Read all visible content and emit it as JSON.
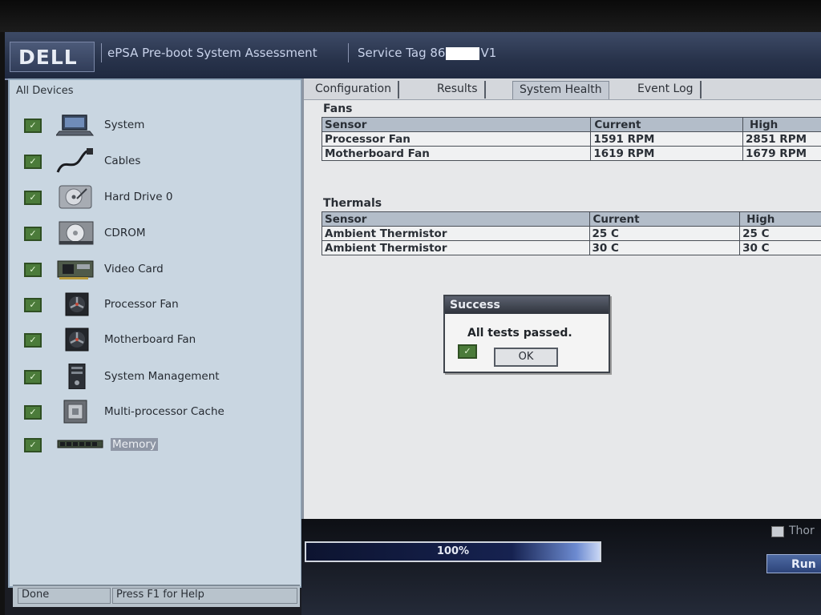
{
  "header": {
    "logo": "DELL",
    "title": "ePSA Pre-boot System Assessment",
    "service_tag_prefix": "Service Tag 86",
    "service_tag_suffix": "V1"
  },
  "left_panel": {
    "title": "All Devices",
    "devices": [
      {
        "label": "System",
        "icon": "laptop-icon",
        "checked": true
      },
      {
        "label": "Cables",
        "icon": "cable-icon",
        "checked": true
      },
      {
        "label": "Hard Drive 0",
        "icon": "hard-drive-icon",
        "checked": true
      },
      {
        "label": "CDROM",
        "icon": "cdrom-icon",
        "checked": true
      },
      {
        "label": "Video Card",
        "icon": "video-card-icon",
        "checked": true
      },
      {
        "label": "Processor Fan",
        "icon": "fan-icon",
        "checked": true
      },
      {
        "label": "Motherboard Fan",
        "icon": "fan-icon",
        "checked": true
      },
      {
        "label": "System Management",
        "icon": "system-management-icon",
        "checked": true
      },
      {
        "label": "Multi-processor Cache",
        "icon": "cpu-chip-icon",
        "checked": true
      },
      {
        "label": "Memory",
        "icon": "memory-module-icon",
        "checked": true,
        "selected": true
      }
    ],
    "status_done": "Done",
    "status_help": "Press F1 for Help"
  },
  "tabs": [
    {
      "label": "Configuration"
    },
    {
      "label": "Results"
    },
    {
      "label": "System Health",
      "active": true
    },
    {
      "label": "Event Log"
    }
  ],
  "fans": {
    "title": "Fans",
    "headers": [
      "Sensor",
      "Current",
      "High"
    ],
    "rows": [
      [
        "Processor Fan",
        "1591 RPM",
        "2851 RPM"
      ],
      [
        "Motherboard Fan",
        "1619 RPM",
        "1679 RPM"
      ]
    ]
  },
  "thermals": {
    "title": "Thermals",
    "headers": [
      "Sensor",
      "Current",
      "High"
    ],
    "rows": [
      [
        "Ambient Thermistor",
        "25 C",
        "25 C"
      ],
      [
        "Ambient Thermistor",
        "30 C",
        "30 C"
      ]
    ]
  },
  "dialog": {
    "title": "Success",
    "message": "All tests passed.",
    "ok_label": "OK"
  },
  "progress": {
    "value_percent": 100,
    "label": "100%"
  },
  "footer": {
    "checkbox_label": "Thor",
    "run_label": "Run"
  },
  "colors": {
    "header_bg": "#28334b",
    "panel_bg": "#c9d6e1",
    "check_green": "#4b7b3a",
    "progress_blue": "#162250"
  }
}
